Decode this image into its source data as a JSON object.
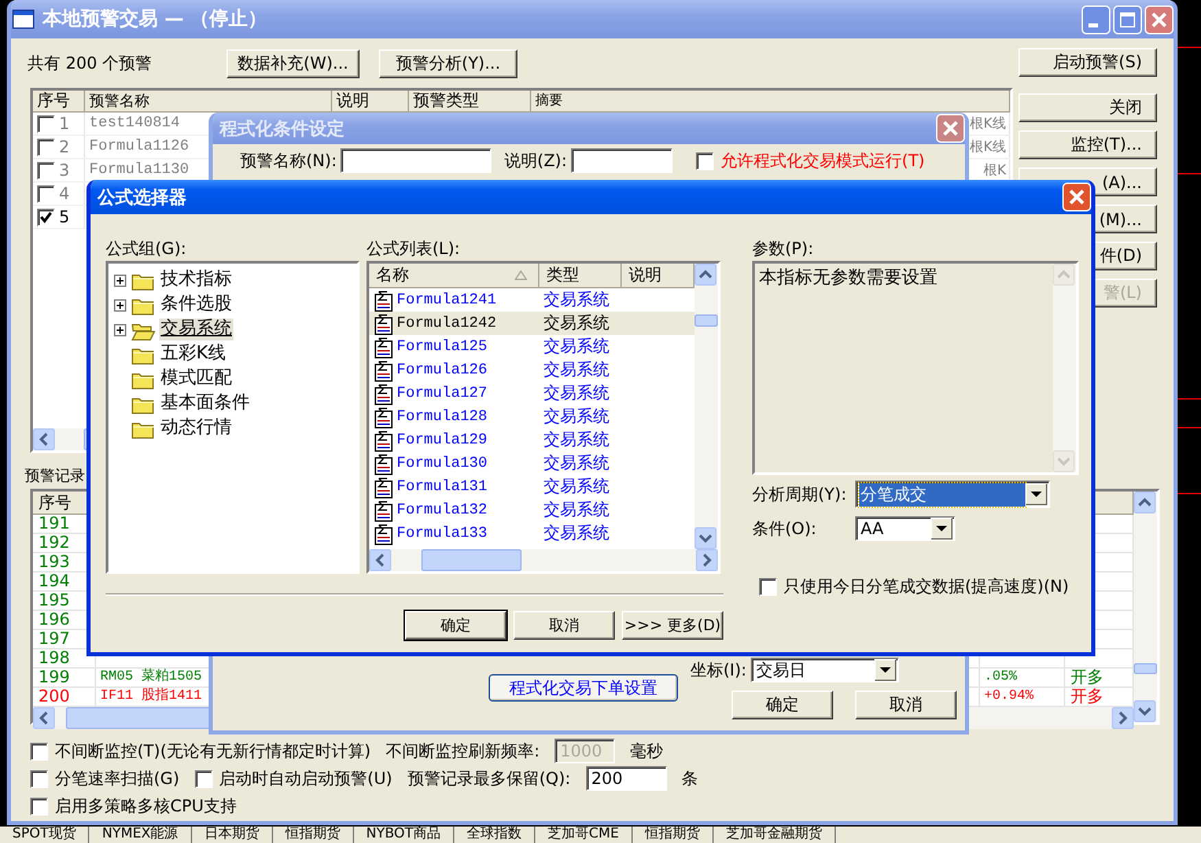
{
  "desktop": {
    "tabs": [
      "SPOT现货",
      "NYMEX能源",
      "日本期货",
      "恒指期货",
      "NYBOT商品",
      "全球指数",
      "芝加哥CME",
      "恒指期货",
      "芝加哥金融期货"
    ]
  },
  "main_window": {
    "title": "本地预警交易 — （停止）",
    "alert_count": "共有 200 个预警",
    "toolbar_buttons": [
      {
        "label": "数据补充(W)..."
      },
      {
        "label": "预警分析(Y)..."
      }
    ],
    "side_buttons": [
      {
        "label": "启动预警(S)",
        "disabled": false
      },
      {
        "label": "关闭",
        "disabled": false
      },
      {
        "label": "监控(T)...",
        "disabled": false
      },
      {
        "label": "(A)...",
        "disabled": false
      },
      {
        "label": "(M)...",
        "disabled": false
      },
      {
        "label": "件(D)",
        "disabled": false
      },
      {
        "label": "警(L)",
        "disabled": true
      }
    ],
    "alerts_table": {
      "columns": [
        "序号",
        "预警名称",
        "说明",
        "预警类型",
        "摘要"
      ],
      "rows": [
        {
          "index": "1",
          "name": "test140814",
          "summary": "根K线",
          "checked": false
        },
        {
          "index": "2",
          "name": "Formula1126",
          "summary": "根K线",
          "checked": false
        },
        {
          "index": "3",
          "name": "Formula1130",
          "summary": "根K",
          "checked": false
        },
        {
          "index": "4",
          "checked": false
        },
        {
          "index": "5",
          "checked": true
        }
      ]
    },
    "records_label": "预警记录",
    "records_table": {
      "columns": [
        "序号"
      ],
      "rows": [
        {
          "index": "191",
          "color": "#008000"
        },
        {
          "index": "192",
          "color": "#008000"
        },
        {
          "index": "193",
          "color": "#008000"
        },
        {
          "index": "194",
          "color": "#008000"
        },
        {
          "index": "195",
          "color": "#008000"
        },
        {
          "index": "196",
          "color": "#008000"
        },
        {
          "index": "197",
          "color": "#008000"
        },
        {
          "index": "198",
          "color": "#008000"
        },
        {
          "index": "199",
          "item": "RM05 菜粕1505",
          "change": ".05%",
          "action": "开多",
          "color": "#008000"
        },
        {
          "index": "200",
          "item": "IF11 股指1411",
          "change": "+0.94%",
          "action": "开多",
          "color": "#ff0000"
        }
      ]
    },
    "options": [
      {
        "items": [
          {
            "kind": "checkbox",
            "label": "不间断监控(T)(无论有无新行情都定时计算)",
            "checked": false
          },
          {
            "kind": "text",
            "text": "不间断监控刷新频率:"
          },
          {
            "kind": "field",
            "value": "1000",
            "disabled": true
          },
          {
            "kind": "text",
            "text": "毫秒"
          }
        ]
      },
      {
        "items": [
          {
            "kind": "checkbox",
            "label": "分笔速率扫描(G)",
            "checked": false
          },
          {
            "kind": "checkbox",
            "label": "启动时自动启动预警(U)",
            "checked": false
          },
          {
            "kind": "text",
            "text": "预警记录最多保留(Q):"
          },
          {
            "kind": "field",
            "value": "200",
            "disabled": false
          },
          {
            "kind": "text",
            "text": "条"
          }
        ]
      },
      {
        "items": [
          {
            "kind": "checkbox",
            "label": "启用多策略多核CPU支持",
            "checked": false
          }
        ]
      }
    ]
  },
  "program_dialog": {
    "title": "程式化条件设定",
    "name_label": "预警名称(N):",
    "note_label": "说明(Z):",
    "allow_checkbox": {
      "label": "允许程式化交易模式运行(T)",
      "checked": false
    },
    "order_button": "程式化交易下单设置",
    "axis": {
      "label": "坐标(I):",
      "value": "交易日"
    },
    "buttons": [
      {
        "label": "确定"
      },
      {
        "label": "取消"
      }
    ]
  },
  "formula_dialog": {
    "title": "公式选择器",
    "group_label": "公式组(G):",
    "groups": [
      {
        "label": "技术指标",
        "kind": "branch",
        "selected": false
      },
      {
        "label": "条件选股",
        "kind": "branch",
        "selected": false
      },
      {
        "label": "交易系统",
        "kind": "branch",
        "selected": true
      },
      {
        "label": "五彩K线",
        "kind": "leaf",
        "selected": false
      },
      {
        "label": "模式匹配",
        "kind": "leaf",
        "selected": false
      },
      {
        "label": "基本面条件",
        "kind": "leaf",
        "selected": false
      },
      {
        "label": "动态行情",
        "kind": "leaf",
        "selected": false
      }
    ],
    "list_label": "公式列表(L):",
    "columns": [
      {
        "label": "名称",
        "sorted": true
      },
      {
        "label": "类型",
        "sorted": false
      },
      {
        "label": "说明",
        "sorted": false
      }
    ],
    "formulas": [
      {
        "name": "Formula1241",
        "type": "交易系统",
        "selected": false
      },
      {
        "name": "Formula1242",
        "type": "交易系统",
        "selected": true
      },
      {
        "name": "Formula125",
        "type": "交易系统",
        "selected": false
      },
      {
        "name": "Formula126",
        "type": "交易系统",
        "selected": false
      },
      {
        "name": "Formula127",
        "type": "交易系统",
        "selected": false
      },
      {
        "name": "Formula128",
        "type": "交易系统",
        "selected": false
      },
      {
        "name": "Formula129",
        "type": "交易系统",
        "selected": false
      },
      {
        "name": "Formula130",
        "type": "交易系统",
        "selected": false
      },
      {
        "name": "Formula131",
        "type": "交易系统",
        "selected": false
      },
      {
        "name": "Formula132",
        "type": "交易系统",
        "selected": false
      },
      {
        "name": "Formula133",
        "type": "交易系统",
        "selected": false
      }
    ],
    "params_label": "参数(P):",
    "params_text": "本指标无参数需要设置",
    "period": {
      "label": "分析周期(Y):",
      "value": "分笔成交",
      "focused": true
    },
    "condition": {
      "label": "条件(O):",
      "value": "AA",
      "focused": false
    },
    "tick_checkbox": {
      "label": "只使用今日分笔成交数据(提高速度)(N)",
      "checked": false
    },
    "buttons": [
      {
        "label": "确定",
        "default": true
      },
      {
        "label": "取消",
        "default": false
      },
      {
        "label": ">>> 更多(D)",
        "default": false
      }
    ]
  }
}
